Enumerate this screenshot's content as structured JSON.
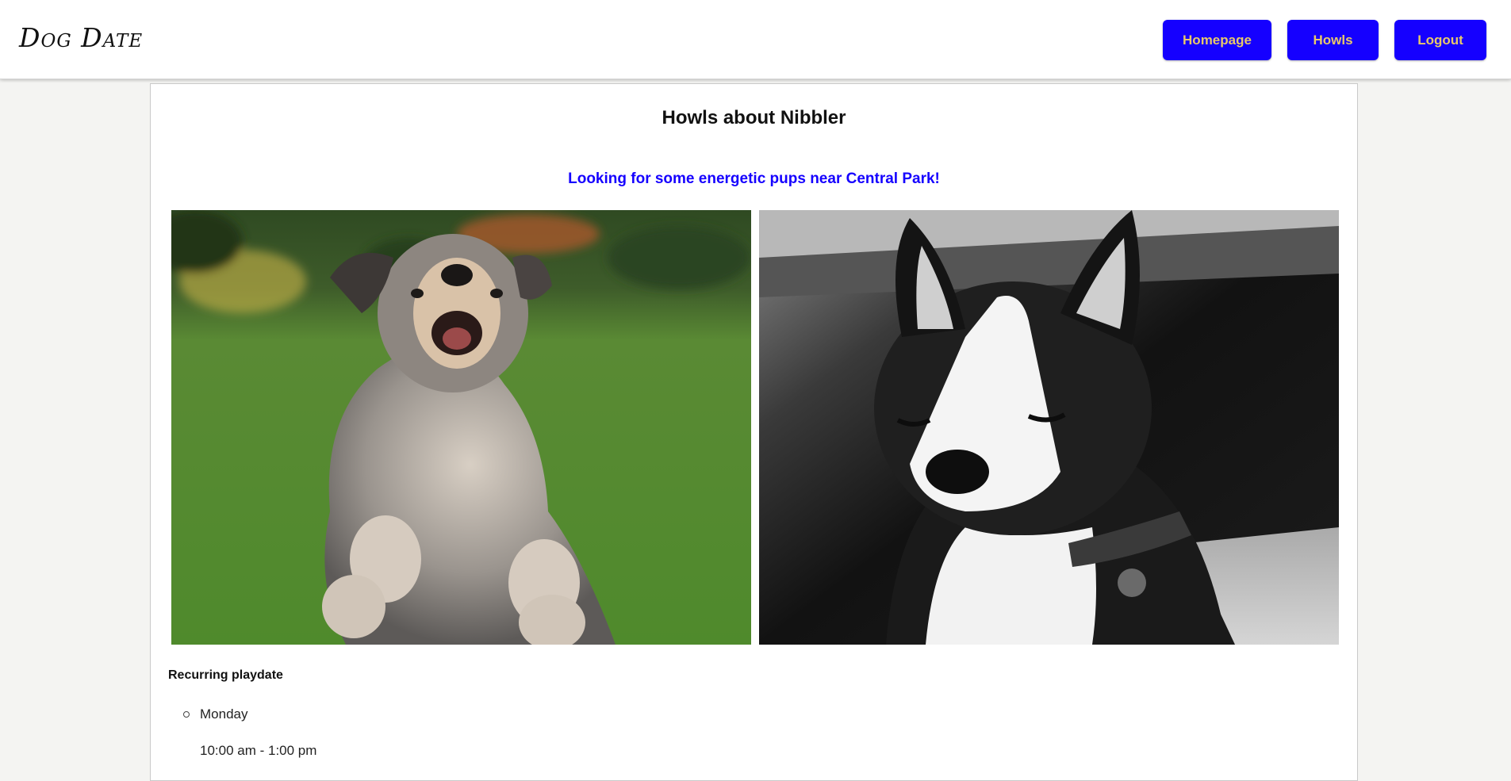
{
  "app": {
    "logo": "Dog Date"
  },
  "nav": {
    "items": [
      {
        "label": "Homepage"
      },
      {
        "label": "Howls"
      },
      {
        "label": "Logout"
      }
    ],
    "button_color": "#1500ff",
    "label_color": "#e8c86a"
  },
  "main": {
    "title": "Howls about Nibbler",
    "howl_text": "Looking for some energetic pups near Central Park!",
    "photos": [
      {
        "subject": "schnauzer-jumping-on-grass"
      },
      {
        "subject": "boston-terrier-black-and-white"
      }
    ],
    "schedule": {
      "label": "Recurring playdate",
      "items": [
        {
          "day": "Monday",
          "time": "10:00 am - 1:00 pm"
        }
      ]
    }
  }
}
